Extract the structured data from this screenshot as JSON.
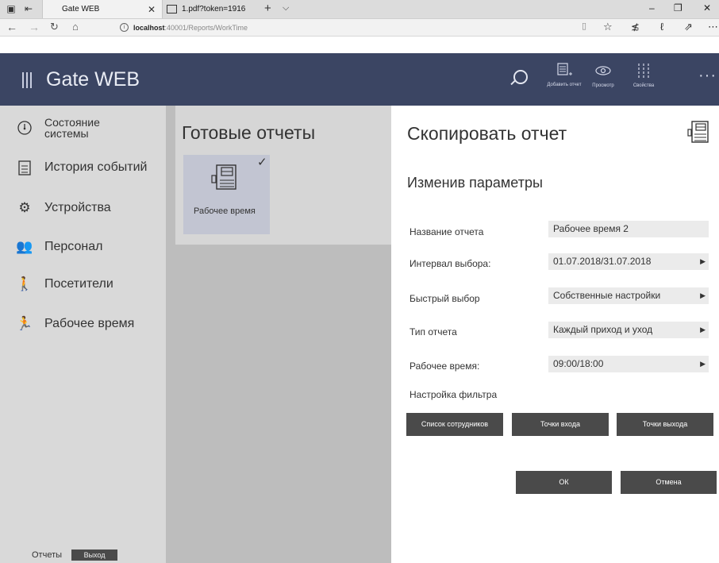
{
  "browser": {
    "active_tab_title": "Gate WEB",
    "second_tab_title": "1.pdf?token=1916",
    "url_host": "localhost",
    "url_path": ":40001/Reports/WorkTime"
  },
  "app": {
    "title": "Gate WEB",
    "header_buttons": {
      "add_report": "Добавить отчет",
      "preview": "Просмотр",
      "properties": "Свойства"
    }
  },
  "sidebar": {
    "items": [
      {
        "label": "Состояние системы",
        "icon": "gauge-icon"
      },
      {
        "label": "История событий",
        "icon": "history-icon"
      },
      {
        "label": "Устройства",
        "icon": "gear-icon"
      },
      {
        "label": "Персонал",
        "icon": "people-icon"
      },
      {
        "label": "Посетители",
        "icon": "visitor-icon"
      },
      {
        "label": "Рабочее время",
        "icon": "worktime-icon"
      }
    ],
    "footer_reports": "Отчеты",
    "footer_exit": "Выход"
  },
  "middle": {
    "title": "Готовые отчеты",
    "report_card_label": "Рабочее время"
  },
  "panel": {
    "title": "Скопировать отчет",
    "subtitle": "Изменив параметры",
    "fields": [
      {
        "label": "Название отчета",
        "value": "Рабочее время 2"
      },
      {
        "label": "Интервал выбора:",
        "value": "01.07.2018/31.07.2018"
      },
      {
        "label": "Быстрый выбор",
        "value": "Собственные настройки"
      },
      {
        "label": "Тип отчета",
        "value": "Каждый приход и уход"
      },
      {
        "label": "Рабочее время:",
        "value": "09:00/18:00"
      }
    ],
    "filter_label": "Настройка фильтра",
    "filter_buttons": [
      "Список сотрудников",
      "Точки входа",
      "Точки выхода"
    ],
    "ok_label": "ОК",
    "cancel_label": "Отмена"
  },
  "colors": {
    "header_bg": "#3b4563",
    "sidebar_bg": "#d9d9d9",
    "card_bg": "#c2c5d2",
    "button_bg": "#4a4a4a"
  }
}
